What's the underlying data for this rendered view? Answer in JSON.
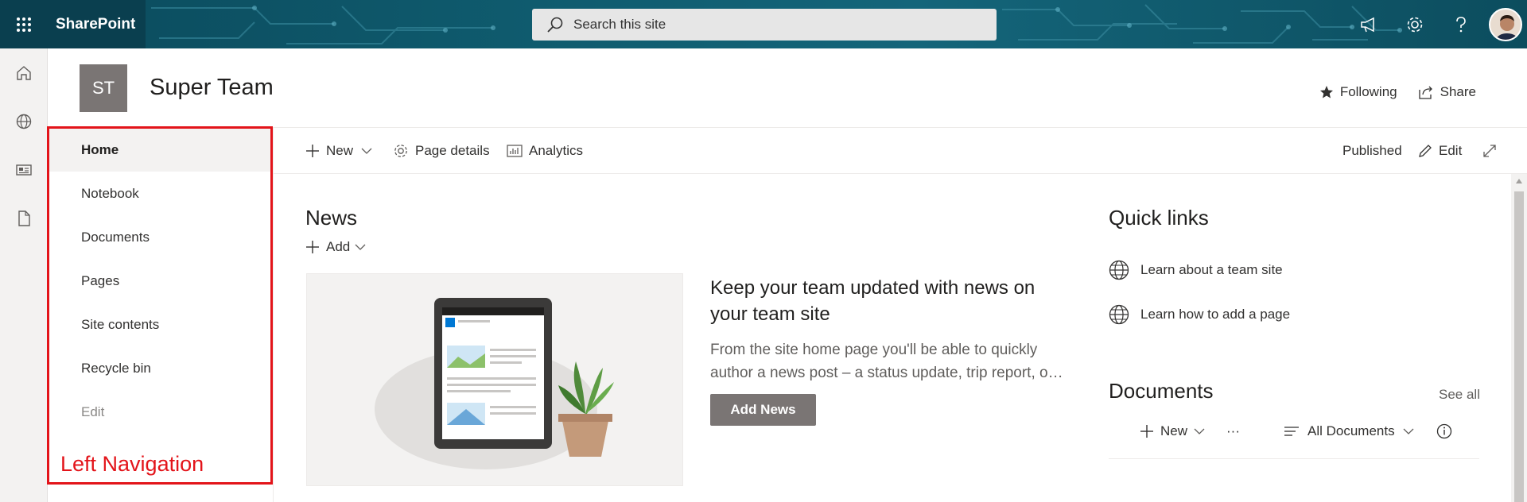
{
  "suite": {
    "brand": "SharePoint",
    "search_placeholder": "Search this site"
  },
  "site": {
    "logo_initials": "ST",
    "title": "Super Team",
    "following_label": "Following",
    "share_label": "Share"
  },
  "leftnav": {
    "items": [
      {
        "label": "Home",
        "selected": true
      },
      {
        "label": "Notebook"
      },
      {
        "label": "Documents"
      },
      {
        "label": "Pages"
      },
      {
        "label": "Site contents"
      },
      {
        "label": "Recycle bin"
      },
      {
        "label": "Edit"
      }
    ],
    "annotation": "Left Navigation"
  },
  "commandbar": {
    "new_label": "New",
    "page_details_label": "Page details",
    "analytics_label": "Analytics",
    "status": "Published",
    "edit_label": "Edit"
  },
  "news": {
    "title": "News",
    "add_label": "Add",
    "headline": "Keep your team updated with news on your team site",
    "description": "From the site home page you'll be able to quickly author a news post – a status update, trip report, o…",
    "add_news_button": "Add News"
  },
  "quicklinks": {
    "title": "Quick links",
    "items": [
      {
        "label": "Learn about a team site"
      },
      {
        "label": "Learn how to add a page"
      }
    ]
  },
  "documents": {
    "title": "Documents",
    "see_all": "See all",
    "new_label": "New",
    "more_label": "···",
    "view_label": "All Documents"
  },
  "colors": {
    "suite_bar": "#0f5b6e",
    "annotation_red": "#e3141a",
    "site_logo": "#7a7574"
  }
}
